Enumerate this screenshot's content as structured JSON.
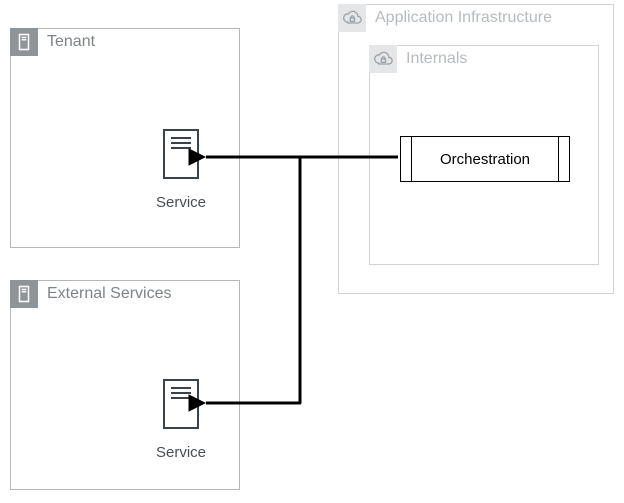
{
  "tenant": {
    "label": "Tenant",
    "service_caption": "Service"
  },
  "external": {
    "label": "External Services",
    "service_caption": "Service"
  },
  "app_infra": {
    "label": "Application Infrastructure",
    "internals_label": "Internals",
    "orchestration_label": "Orchestration"
  }
}
